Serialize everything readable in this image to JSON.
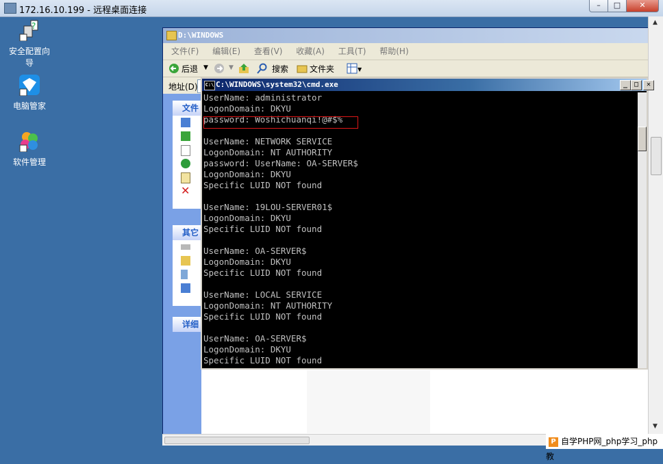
{
  "rdp": {
    "title": "172.16.10.199 - 远程桌面连接",
    "minimize": "–",
    "maximize": "□",
    "close": "✕"
  },
  "desktop": {
    "icons": [
      {
        "label": "安全配置向导",
        "icon": "security-wizard-icon"
      },
      {
        "label": "电脑管家",
        "icon": "pc-manager-icon"
      },
      {
        "label": "软件管理",
        "icon": "software-manager-icon"
      }
    ]
  },
  "explorer": {
    "title": "D:\\WINDOWS",
    "menu": [
      "文件(F)",
      "编辑(E)",
      "查看(V)",
      "收藏(A)",
      "工具(T)",
      "帮助(H)"
    ],
    "toolbar": {
      "back": "后退",
      "search": "搜索",
      "folders": "文件夹"
    },
    "address_label": "地址(D)",
    "panels": [
      {
        "title": "文件"
      },
      {
        "title": "其它"
      },
      {
        "title": "详细"
      }
    ]
  },
  "cmd": {
    "title": "C:\\WINDOWS\\system32\\cmd.exe",
    "lines": [
      "UserName: administrator",
      "LogonDomain: DKYU",
      "password: Woshichuanqi!@#$%",
      "",
      "UserName: NETWORK SERVICE",
      "LogonDomain: NT AUTHORITY",
      "password: UserName: OA-SERVER$",
      "LogonDomain: DKYU",
      "Specific LUID NOT found",
      "",
      "UserName: 19LOU-SERVER01$",
      "LogonDomain: DKYU",
      "Specific LUID NOT found",
      "",
      "UserName: OA-SERVER$",
      "LogonDomain: DKYU",
      "Specific LUID NOT found",
      "",
      "UserName: LOCAL SERVICE",
      "LogonDomain: NT AUTHORITY",
      "Specific LUID NOT found",
      "",
      "UserName: OA-SERVER$",
      "LogonDomain: DKYU",
      "Specific LUID NOT found"
    ]
  },
  "watermark": {
    "logo": "P",
    "text": "自学PHP网_php学习_php教"
  },
  "colors": {
    "desktop": "#3a6ea5",
    "highlight": "#e01818"
  }
}
